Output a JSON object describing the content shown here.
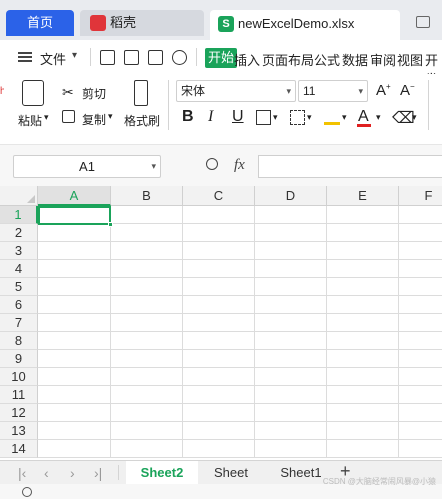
{
  "tabs": [
    {
      "label": "首页"
    },
    {
      "label": "稻壳"
    },
    {
      "label": "newExcelDemo.xlsx"
    }
  ],
  "menu": {
    "file_label": "文件",
    "start_label": "开始",
    "items": [
      "插入",
      "页面布局",
      "公式",
      "数据",
      "审阅",
      "视图",
      "开发"
    ]
  },
  "ribbon": {
    "paste_label": "粘贴",
    "cut_label": "剪切",
    "copy_label": "复制",
    "format_painter_label": "格式刷",
    "font_name": "宋体",
    "font_size": "11"
  },
  "formula_bar": {
    "name_box": "A1",
    "fx_label": "fx",
    "formula_value": ""
  },
  "grid": {
    "columns": [
      "A",
      "B",
      "C",
      "D",
      "E",
      "F"
    ],
    "rows": [
      "1",
      "2",
      "3",
      "4",
      "5",
      "6",
      "7",
      "8",
      "9",
      "10",
      "11",
      "12",
      "13",
      "14"
    ],
    "active_cell": "A1"
  },
  "sheets": [
    {
      "label": "Sheet2",
      "active": true
    },
    {
      "label": "Sheet",
      "active": false
    },
    {
      "label": "Sheet1",
      "active": false
    }
  ],
  "watermark": "CSDN @大脑经常闹风暴@小猿",
  "colors": {
    "accent": "#1aa35a",
    "home_tab": "#2b62e8",
    "docer_red": "#e0353a"
  }
}
